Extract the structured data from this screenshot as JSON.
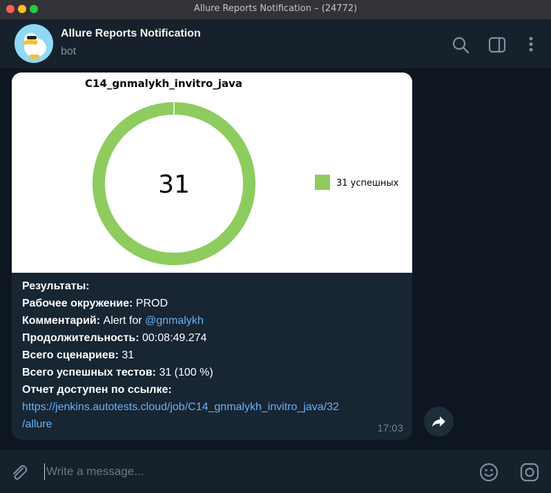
{
  "window": {
    "title": "Allure Reports Notification – (24772)"
  },
  "header": {
    "name": "Allure Reports Notification",
    "status": "bot"
  },
  "chart_data": {
    "type": "pie",
    "title": "C14_gnmalykh_invitro_java",
    "center_label": "31",
    "series": [
      {
        "name": "31 успешных",
        "values": [
          31
        ],
        "color": "#8fcc5f"
      }
    ],
    "legend_position": "right"
  },
  "message": {
    "lines": {
      "results": "Результаты:",
      "env_label": "Рабочее окружение:",
      "env_value": "PROD",
      "comment_label": "Комментарий:",
      "comment_value": "Alert for",
      "comment_mention": "@gnmalykh",
      "duration_label": "Продолжительность:",
      "duration_value": "00:08:49.274",
      "scenarios_label": "Всего сценариев:",
      "scenarios_value": "31",
      "passed_label": "Всего успешных тестов:",
      "passed_value": "31 (100 %)",
      "report_label": "Отчет доступен по ссылке:",
      "link_line1": "https://jenkins.autotests.cloud/job/C14_gnmalykh_invitro_java/32",
      "link_line2": "/allure"
    },
    "time": "17:03"
  },
  "composer": {
    "placeholder": "Write a message..."
  },
  "icons": {
    "search": "search-icon",
    "sidebar": "sidebar-toggle-icon",
    "more": "more-vertical-icon",
    "attach": "paperclip-icon",
    "emoji": "emoji-icon",
    "camera": "camera-icon",
    "share": "share-arrow-icon"
  },
  "colors": {
    "accent": "#6ab3f3",
    "chart_green": "#8fcc5f",
    "background": "#0e1621",
    "bubble": "#182533"
  }
}
